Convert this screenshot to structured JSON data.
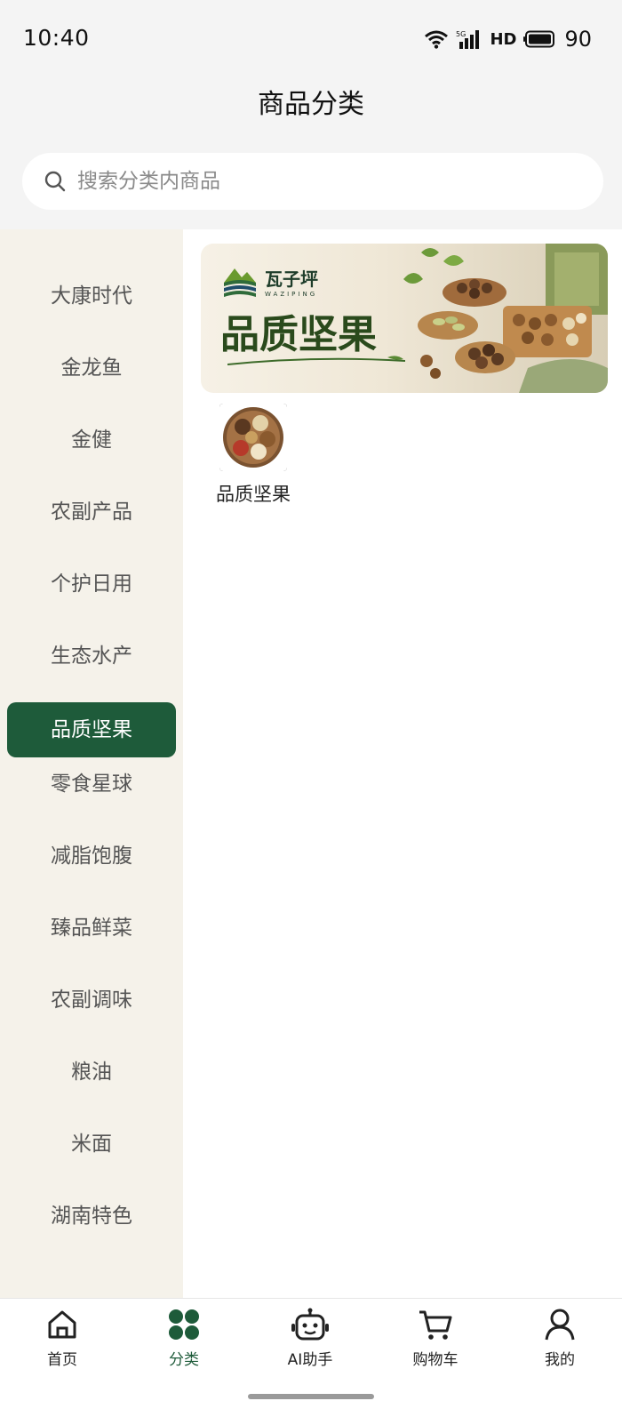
{
  "status_bar": {
    "time": "10:40",
    "network": "5G",
    "hd": "HD",
    "battery": "90"
  },
  "header": {
    "title": "商品分类"
  },
  "search": {
    "placeholder": "搜索分类内商品"
  },
  "sidebar": {
    "items": [
      {
        "label": "大康时代"
      },
      {
        "label": "金龙鱼"
      },
      {
        "label": "金健"
      },
      {
        "label": "农副产品"
      },
      {
        "label": "个护日用"
      },
      {
        "label": "生态水产"
      },
      {
        "label": "品质坚果",
        "active": true
      },
      {
        "label": "零食星球"
      },
      {
        "label": "减脂饱腹"
      },
      {
        "label": "臻品鲜菜"
      },
      {
        "label": "农副调味"
      },
      {
        "label": "粮油"
      },
      {
        "label": "米面"
      },
      {
        "label": "湖南特色"
      }
    ]
  },
  "banner": {
    "brand": "瓦子坪",
    "brand_sub": "WAZIPING",
    "title": "品质坚果"
  },
  "subcategories": [
    {
      "label": "品质坚果"
    }
  ],
  "tabbar": {
    "items": [
      {
        "label": "首页",
        "icon": "home-icon"
      },
      {
        "label": "分类",
        "icon": "category-icon",
        "active": true
      },
      {
        "label": "AI助手",
        "icon": "robot-icon"
      },
      {
        "label": "购物车",
        "icon": "cart-icon"
      },
      {
        "label": "我的",
        "icon": "user-icon"
      }
    ]
  },
  "colors": {
    "accent": "#1e5b3a",
    "sidebar_bg": "#f5f2ea",
    "top_bg": "#f4f4f4"
  }
}
